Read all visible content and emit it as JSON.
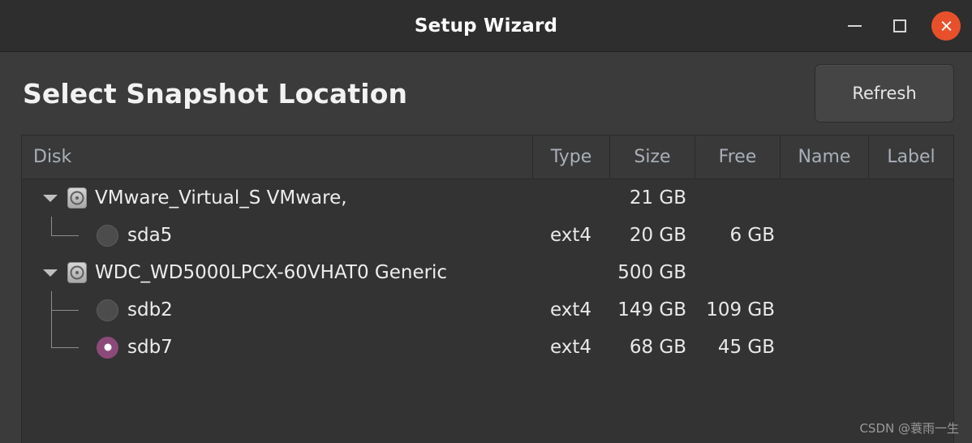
{
  "window": {
    "title": "Setup Wizard",
    "controls": {
      "minimize": "minimize",
      "maximize": "maximize",
      "close": "close"
    },
    "close_color": "#e8502b"
  },
  "header": {
    "page_title": "Select Snapshot Location",
    "refresh_label": "Refresh"
  },
  "table": {
    "columns": [
      {
        "key": "disk",
        "label": "Disk"
      },
      {
        "key": "type",
        "label": "Type"
      },
      {
        "key": "size",
        "label": "Size"
      },
      {
        "key": "free",
        "label": "Free"
      },
      {
        "key": "name",
        "label": "Name"
      },
      {
        "key": "label",
        "label": "Label"
      }
    ],
    "rows": [
      {
        "kind": "disk",
        "expanded": true,
        "icon": "hard-disk-icon",
        "disk": "VMware_Virtual_S VMware,",
        "type": "",
        "size": "21 GB",
        "free": "",
        "name": "",
        "label": ""
      },
      {
        "kind": "partition",
        "selected": false,
        "last_child": true,
        "disk": "sda5",
        "type": "ext4",
        "size": "20 GB",
        "free": "6 GB",
        "name": "",
        "label": ""
      },
      {
        "kind": "disk",
        "expanded": true,
        "icon": "hard-disk-icon",
        "disk": "WDC_WD5000LPCX-60VHAT0 Generic",
        "type": "",
        "size": "500 GB",
        "free": "",
        "name": "",
        "label": ""
      },
      {
        "kind": "partition",
        "selected": false,
        "last_child": false,
        "disk": "sdb2",
        "type": "ext4",
        "size": "149 GB",
        "free": "109 GB",
        "name": "",
        "label": ""
      },
      {
        "kind": "partition",
        "selected": true,
        "last_child": true,
        "disk": "sdb7",
        "type": "ext4",
        "size": "68 GB",
        "free": "45 GB",
        "name": "",
        "label": ""
      }
    ],
    "selected_radio_color": "#8b4a79"
  },
  "watermark": "CSDN @蓑雨一生"
}
